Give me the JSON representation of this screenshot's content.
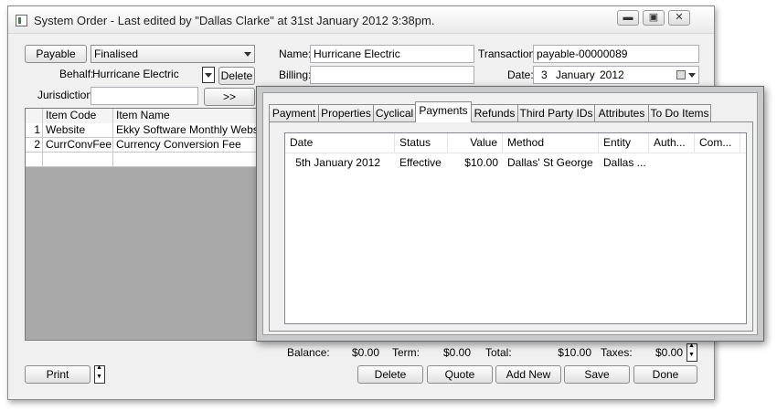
{
  "window": {
    "title": "System Order - Last edited by \"Dallas Clarke\" at 31st January 2012 3:38pm.",
    "minimize": "▬",
    "maximize": "▣",
    "close": "✕"
  },
  "left": {
    "payable_button": "Payable",
    "status_select": "Finalised",
    "behalf_label": "Behalf:",
    "behalf_value": "Hurricane Electric",
    "delete_button": "Delete",
    "jurisdiction_label": "Jurisdiction:",
    "jurisdiction_value": "",
    "expand_button": ">>"
  },
  "grid": {
    "headers": [
      "",
      "Item Code",
      "Item Name"
    ],
    "rows": [
      {
        "num": "1",
        "code": "Website",
        "name": "Ekky Software Monthly Website"
      },
      {
        "num": "2",
        "code": "CurrConvFee",
        "name": "Currency Conversion Fee"
      },
      {
        "num": "",
        "code": "",
        "name": ""
      }
    ]
  },
  "form": {
    "name_label": "Name:",
    "name_value": "Hurricane Electric",
    "transaction_label": "Transaction:",
    "transaction_value": "payable-00000089",
    "billing_label": "Billing:",
    "billing_value": "",
    "date_label": "Date:",
    "date_day": "3",
    "date_month": "January",
    "date_year": "2012"
  },
  "popup": {
    "tabs": [
      "Payment",
      "Properties",
      "Cyclical",
      "Payments",
      "Refunds",
      "Third Party IDs",
      "Attributes",
      "To Do Items"
    ],
    "active_tab": "Payments",
    "columns": [
      "Date",
      "Status",
      "Value",
      "Method",
      "Entity",
      "Auth...",
      "Com..."
    ],
    "rows": [
      {
        "date": "5th January 2012",
        "status": "Effective",
        "value": "$10.00",
        "method": "Dallas' St George",
        "entity": "Dallas ...",
        "auth": "",
        "com": ""
      }
    ]
  },
  "totals": {
    "balance_label": "Balance:",
    "balance_value": "$0.00",
    "term_label": "Term:",
    "term_value": "$0.00",
    "total_label": "Total:",
    "total_value": "$10.00",
    "taxes_label": "Taxes:",
    "taxes_value": "$0.00"
  },
  "buttons": {
    "print": "Print",
    "delete": "Delete",
    "quote": "Quote",
    "add_new": "Add New",
    "save": "Save",
    "done": "Done"
  }
}
